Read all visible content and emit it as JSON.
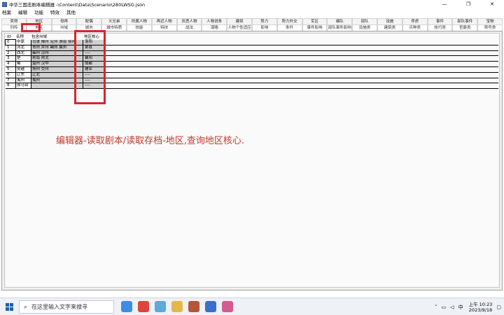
{
  "window": {
    "title": "中华三国志剧本编辑器 -\\Content\\Data\\Scenario\\280LWSG.json",
    "minimize": "—",
    "maximize": "❐",
    "close": "✕"
  },
  "menu": [
    "档案",
    "编辑",
    "功能",
    "特效",
    "其他"
  ],
  "tabs_row1": [
    "奖得",
    "地区",
    "母再",
    "配偶",
    "义兄弟",
    "所属人物",
    "再近人物",
    "厌恶人物",
    "人物说条",
    "建筑",
    "势力",
    "势力外交",
    "军区",
    "编队",
    "部队",
    "设施",
    "俘虏",
    "事件",
    "部队事件",
    "宝物"
  ],
  "tabs_row2": [
    "列传",
    "地区",
    "州域",
    "城市",
    "城市特质",
    "技能",
    "特技",
    "战法",
    "谋略",
    "人物个性适应",
    "影响",
    "条件",
    "事件影响",
    "部队事件影响",
    "设施类",
    "建筑类",
    "兵种类",
    "技巧类",
    "官爵类",
    "称号类"
  ],
  "grid": {
    "headers": {
      "id": "ID",
      "name": "名称",
      "districts": "包含州域",
      "core": "地区核心"
    },
    "rows": [
      {
        "id": "0",
        "name": "中原",
        "districts": "司隶 豫州 兖州 淮南 徐州",
        "core": "洛阳"
      },
      {
        "id": "1",
        "name": "河北",
        "districts": "青州 并州 幽州 冀州",
        "core": "邺县"
      },
      {
        "id": "2",
        "name": "西北",
        "districts": "雍州 凉州",
        "core": "----"
      },
      {
        "id": "3",
        "name": "楚",
        "districts": "荆南 荆北",
        "core": "襄阳"
      },
      {
        "id": "4",
        "name": "蜀",
        "districts": "益州 汉中",
        "core": "成都"
      },
      {
        "id": "5",
        "name": "吴越",
        "districts": "扬州 交州",
        "core": "建业"
      },
      {
        "id": "6",
        "name": "辽东",
        "districts": "辽北",
        "core": "----"
      },
      {
        "id": "7",
        "name": "夷州",
        "districts": "夷州",
        "core": "----"
      },
      {
        "id": "8",
        "name": "邪马台",
        "districts": "",
        "core": "----"
      }
    ]
  },
  "annotation": "编辑器-读取剧本/读取存档-地区,查询地区核心.",
  "taskbar": {
    "search_placeholder": "在这里输入文字来搜寻",
    "ime": "中",
    "time": "上午 10:23",
    "date": "2023/9/18",
    "icon_colors": [
      "#3a8ee6",
      "#e0443a",
      "#5fa8d8",
      "#e6b84a",
      "#b5563a",
      "#3c6fc9",
      "#d45a8f"
    ]
  }
}
